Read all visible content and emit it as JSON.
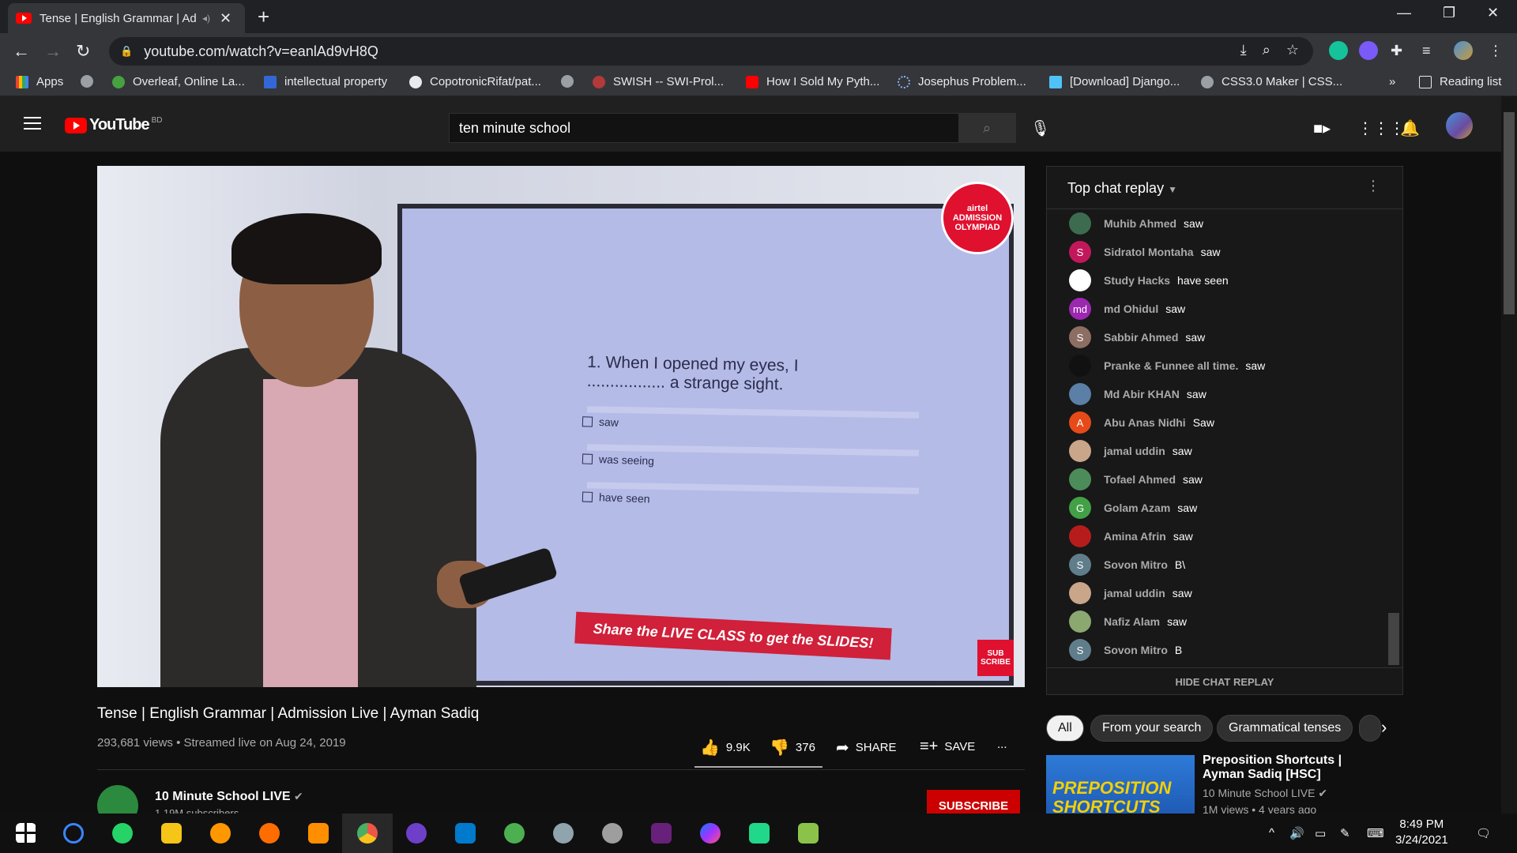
{
  "browser": {
    "tab_title": "Tense | English Grammar | Ad",
    "url": "youtube.com/watch?v=eanlAd9vH8Q",
    "bookmarks": [
      "Apps",
      "Overleaf, Online La...",
      "intellectual property",
      "CopotronicRifat/pat...",
      "SWISH -- SWI-Prol...",
      "How I Sold My Pyth...",
      "Josephus Problem...",
      "[Download] Django...",
      "CSS3.0 Maker | CSS...",
      "Reading list"
    ],
    "bookmarks_overflow": "»"
  },
  "youtube": {
    "logo_text": "YouTube",
    "country_code": "BD",
    "search_value": "ten minute school"
  },
  "video": {
    "question": "1. When I opened my eyes, I ................. a strange sight.",
    "options": [
      "saw",
      "was seeing",
      "have seen"
    ],
    "badge": "airtel ADMISSION OLYMPIAD",
    "banner": "Share the LIVE CLASS to get the SLIDES!",
    "subscribe_mark": "SUB SCRIBE",
    "title": "Tense | English Grammar | Admission Live | Ayman Sadiq",
    "meta": "293,681 views • Streamed live on Aug 24, 2019",
    "likes": "9.9K",
    "dislikes": "376",
    "share": "SHARE",
    "save": "SAVE",
    "more": "...",
    "channel": "10 Minute School LIVE",
    "subscribers": "1.19M subscribers",
    "subscribe": "SUBSCRIBE"
  },
  "chat": {
    "header": "Top chat replay",
    "hide": "HIDE CHAT REPLAY",
    "messages": [
      {
        "author": "Muhib Ahmed",
        "text": "saw",
        "initial": "",
        "color": "#3d6b4f"
      },
      {
        "author": "Sidratol Montaha",
        "text": "saw",
        "initial": "S",
        "color": "#c2185b"
      },
      {
        "author": "Study Hacks",
        "text": "have seen",
        "initial": "",
        "color": "#ffffff"
      },
      {
        "author": "md Ohidul",
        "text": "saw",
        "initial": "md",
        "color": "#9c27b0"
      },
      {
        "author": "Sabbir Ahmed",
        "text": "saw",
        "initial": "S",
        "color": "#8d6e63"
      },
      {
        "author": "Pranke & Funnee all time.",
        "text": "saw",
        "initial": "",
        "color": "#111111"
      },
      {
        "author": "Md Abir KHAN",
        "text": "saw",
        "initial": "",
        "color": "#5b7fa6"
      },
      {
        "author": "Abu Anas Nidhi",
        "text": "Saw",
        "initial": "A",
        "color": "#e64a19"
      },
      {
        "author": "jamal uddin",
        "text": "saw",
        "initial": "",
        "color": "#c9a58a"
      },
      {
        "author": "Tofael Ahmed",
        "text": "saw",
        "initial": "",
        "color": "#4c8c5a"
      },
      {
        "author": "Golam Azam",
        "text": "saw",
        "initial": "G",
        "color": "#43a047"
      },
      {
        "author": "Amina Afrin",
        "text": "saw",
        "initial": "",
        "color": "#b71c1c"
      },
      {
        "author": "Sovon Mitro",
        "text": "B\\",
        "initial": "S",
        "color": "#607d8b"
      },
      {
        "author": "jamal uddin",
        "text": "saw",
        "initial": "",
        "color": "#c9a58a"
      },
      {
        "author": "Nafiz Alam",
        "text": "saw",
        "initial": "",
        "color": "#8aa870"
      },
      {
        "author": "Sovon Mitro",
        "text": "B",
        "initial": "S",
        "color": "#607d8b"
      }
    ]
  },
  "chips": [
    "All",
    "From your search",
    "Grammatical tenses"
  ],
  "recommendation": {
    "thumb_text": "PREPOSITION SHORTCUTS",
    "title": "Preposition Shortcuts | Ayman Sadiq [HSC]",
    "channel": "10 Minute School LIVE",
    "meta": "1M views • 4 years ago"
  },
  "taskbar": {
    "time": "8:49 PM",
    "date": "3/24/2021"
  },
  "colors": {
    "yt_red": "#ff0000",
    "subscribe_red": "#cc0000",
    "background": "#0f0f0f"
  }
}
